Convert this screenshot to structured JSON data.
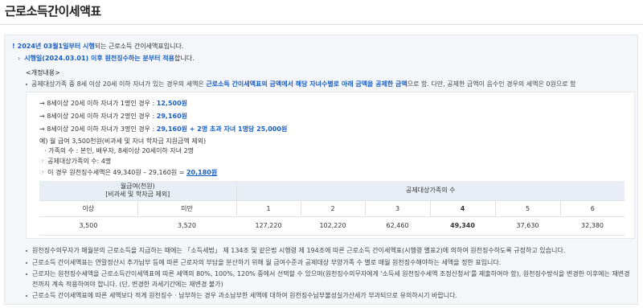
{
  "page": {
    "title": "근로소득간이세액표"
  },
  "notice": {
    "line1_blue": "2024년 03월1일부터 시행",
    "line1_rest": "되는 근로소득 간이세액표입니다.",
    "line2_blue": "시행일(2024.03.01) 이후 원천징수하는 분부터 적용",
    "line2_rest": "합니다."
  },
  "revision": {
    "label": "<개정내용>",
    "desc_pre": "공제대상가족 중 8세 이상 20세 이하 자녀가 있는 경우의 세액은 ",
    "desc_blue": "근로소득 간이세액표의 금액에서 해당 자녀수별로 아래 금액을 공제한 금액",
    "desc_post": "으로 함. 다만, 공제한 금액이 음수인 경우의 세액은 0원으로 함"
  },
  "examples": {
    "child1_text": "→ 8세이상 20세 이하 자녀가 1명인 경우 : ",
    "child1_value": "12,500원",
    "child2_text": "→ 8세이상 20세 이하 자녀가 2명인 경우 : ",
    "child2_value": "29,160원",
    "child3_text": "→ 8세이상 20세 이하 자녀가 3명인 경우 : ",
    "child3_value": "29,160원 + 2명 초과 자녀 1명당 25,000원",
    "example_head": "예) 월 급여 3,500천원(비과세 및 자녀 학자금 지원금액 제외)",
    "family_members": "· 가족의 수 : 본인, 배우자, 8세이상 20세이하 자녀 2명",
    "deduct_count": "공제대상가족의 수: 4명",
    "tax_calc": "이 경우 원천징수세액은 49,340원 – 29,160원 = ",
    "tax_result": "20,180원"
  },
  "table": {
    "header_salary": "월급여(천원)",
    "header_salary_sub": "[비과세 및 학자금 제외]",
    "header_family": "공제대상가족의 수",
    "col_over": "이상",
    "col_under": "미만",
    "family_cols": [
      "1",
      "2",
      "3",
      "4",
      "5",
      "6"
    ],
    "row": {
      "over": "3,500",
      "under": "3,520",
      "values": [
        "127,220",
        "102,220",
        "62,460",
        "49,340",
        "37,630",
        "32,380"
      ]
    }
  },
  "footnotes": [
    "원천징수의무자가 매월분의 근로소득을 지급하는 때에는 「소득세법」 제 134조 및 같은법 시행령 제 194조에 따른 근로소득 간이세액표(시행령 별표2)에 의하여 원천징수하도록 규정하고 있습니다.",
    "근로소득 간이세액표는 연말정산시 추가납부 등에 따른 근로자의 부담을 분산하기 위해 월 급여수준과 공제대상 부양가족 수 별로 매월 원천징수해야하는 세액을 정한 표입니다.",
    "근로자는 원천징수세액을 근로소득간이세액표에 따른 세액의 80%, 100%, 120% 중에서 선택할 수 있으며(원천징수의무자에게 '소득세 원천징수세액 조정신청서'를 제출하여야 함), 원천징수방식을 변경한 이후에는 재변경 전까지 계속 적용하여야 합니다. (단, 변경한 과세기간에는 재변경 불가)",
    "근로소득 간이세액표에 따른 세액보다 적게 원천징수 · 납부하는 경우 과소납부한 세액에 대하여 원천징수납부불성실가산세가 부과되므로 유의하시기 바랍니다."
  ]
}
